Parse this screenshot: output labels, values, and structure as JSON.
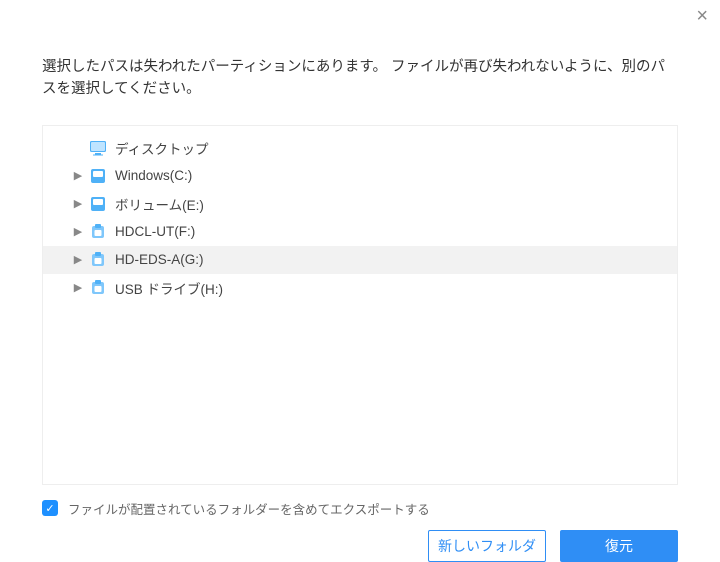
{
  "close_label": "×",
  "message": "選択したパスは失われたパーティションにあります。 ファイルが再び失われないように、別のパスを選択してください。",
  "tree": {
    "items": [
      {
        "label": "ディスクトップ",
        "icon": "desktop",
        "expandable": false,
        "selected": false
      },
      {
        "label": "Windows(C:)",
        "icon": "drive-blue",
        "expandable": true,
        "selected": false
      },
      {
        "label": "ボリューム(E:)",
        "icon": "drive-blue",
        "expandable": true,
        "selected": false
      },
      {
        "label": "HDCL-UT(F:)",
        "icon": "drive-usb",
        "expandable": true,
        "selected": false
      },
      {
        "label": "HD-EDS-A(G:)",
        "icon": "drive-usb",
        "expandable": true,
        "selected": true
      },
      {
        "label": "USB ドライブ(H:)",
        "icon": "drive-usb",
        "expandable": true,
        "selected": false
      }
    ]
  },
  "checkbox": {
    "checked": true,
    "label": "ファイルが配置されているフォルダーを含めてエクスポートする"
  },
  "buttons": {
    "new_folder": "新しいフォルダ",
    "restore": "復元"
  },
  "colors": {
    "accent": "#2f8ef5"
  }
}
